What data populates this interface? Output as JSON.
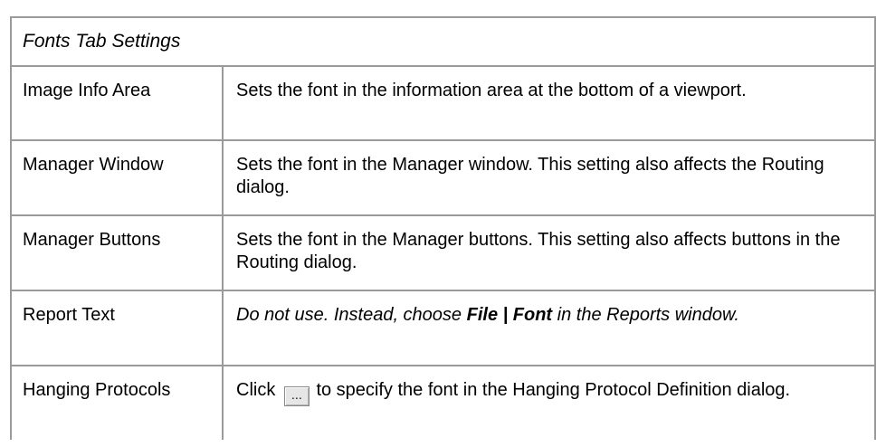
{
  "table": {
    "title": "Fonts Tab Settings",
    "rows": [
      {
        "label": "Image Info Area",
        "description": "Sets the font in the information area at the bottom of a viewport."
      },
      {
        "label": "Manager Window",
        "description": "Sets the font in the Manager window. This setting also affects the Routing dialog."
      },
      {
        "label": "Manager Buttons",
        "description": "Sets the font in the Manager buttons. This setting also affects buttons in the Routing dialog."
      },
      {
        "label": "Report Text",
        "description_part1": "Do not use. Instead, choose ",
        "description_bold": "File | Font",
        "description_part2": " in the Reports window."
      },
      {
        "label": "Hanging Protocols",
        "description_part1": "Click ",
        "button_glyph": "…",
        "button_icon": "ellipsis-browse-icon",
        "description_part2": " to specify the font in the Hanging Protocol Definition dialog."
      }
    ]
  },
  "colors": {
    "border": "#9a9a9a",
    "button_face": "#e6e6e6"
  }
}
